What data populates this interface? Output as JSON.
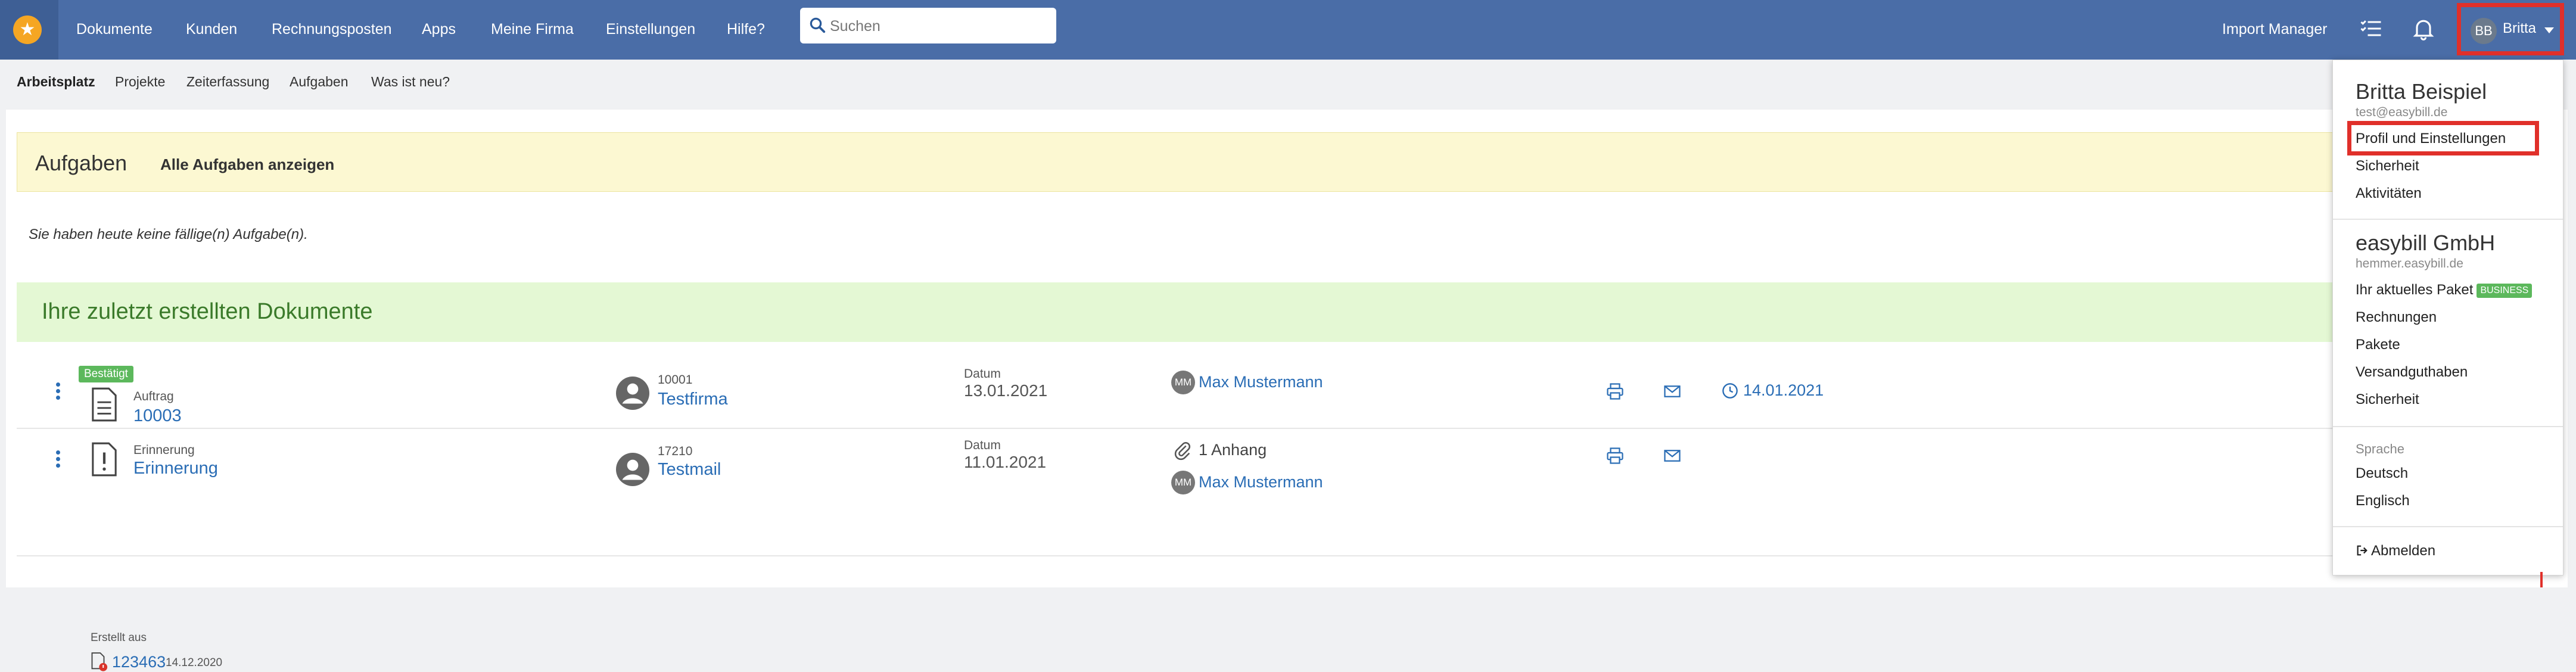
{
  "nav": {
    "items": [
      "Dokumente",
      "Kunden",
      "Rechnungsposten",
      "Apps",
      "Meine Firma",
      "Einstellungen",
      "Hilfe?"
    ],
    "search_placeholder": "Suchen",
    "import_manager": "Import Manager",
    "user_initials": "BB",
    "user_name": "Britta"
  },
  "subnav": {
    "items": [
      "Arbeitsplatz",
      "Projekte",
      "Zeiterfassung",
      "Aufgaben",
      "Was ist neu?"
    ]
  },
  "tasks": {
    "title": "Aufgaben",
    "show_all": "Alle Aufgaben anzeigen",
    "empty_message": "Sie haben heute keine fällige(n) Aufgabe(n)."
  },
  "recent_docs": {
    "title": "Ihre zuletzt erstellten Dokumente",
    "rows": [
      {
        "status": "Bestätigt",
        "doc_type": "Auftrag",
        "doc_number": "10003",
        "customer_number": "10001",
        "customer_name": "Testfirma",
        "date_label": "Datum",
        "date": "13.01.2021",
        "assignee_initials": "MM",
        "assignee": "Max Mustermann",
        "due_date": "14.01.2021"
      },
      {
        "doc_type": "Erinnerung",
        "doc_title": "Erinnerung",
        "customer_number": "17210",
        "customer_name": "Testmail",
        "date_label": "Datum",
        "date": "11.01.2021",
        "attachments": "1 Anhang",
        "assignee_initials": "MM",
        "assignee": "Max Mustermann",
        "created_from_label": "Erstellt aus",
        "created_from_number": "123463",
        "created_from_date": "14.12.2020"
      }
    ]
  },
  "user_menu": {
    "user_name": "Britta Beispiel",
    "user_email": "test@easybill.de",
    "user_items": [
      "Profil und Einstellungen",
      "Sicherheit",
      "Aktivitäten"
    ],
    "company_name": "easybill GmbH",
    "company_domain": "hemmer.easybill.de",
    "package_label": "Ihr aktuelles Paket",
    "package_badge": "BUSINESS",
    "company_items": [
      "Rechnungen",
      "Pakete",
      "Versandguthaben",
      "Sicherheit"
    ],
    "language_label": "Sprache",
    "languages": [
      "Deutsch",
      "Englisch"
    ],
    "logout": "Abmelden"
  },
  "colors": {
    "nav_bg": "#4a6da7",
    "link": "#2a6db5",
    "highlight": "#e0302a",
    "success": "#5cb85c"
  }
}
